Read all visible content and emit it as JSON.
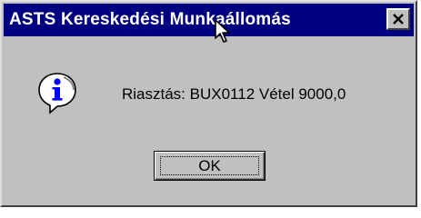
{
  "window": {
    "title": "ASTS Kereskedési Munkaállomás",
    "close_icon": "close-icon"
  },
  "message": {
    "icon": "info-icon",
    "text": "Riasztás: BUX0112 Vétel 9000,0"
  },
  "buttons": {
    "ok_label": "OK"
  },
  "colors": {
    "titlebar": "#000080",
    "dialog_bg": "#c0c0c0",
    "icon_blue": "#0000ff"
  }
}
